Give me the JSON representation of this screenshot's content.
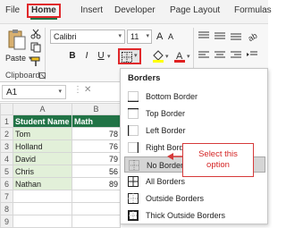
{
  "menu_tabs": [
    "File",
    "Home",
    "Insert",
    "Developer",
    "Page Layout",
    "Formulas"
  ],
  "ribbon": {
    "paste_label": "Paste",
    "clipboard_label": "Clipboard",
    "font_name": "Calibri",
    "font_size": "11",
    "bold": "B",
    "italic": "I",
    "underline": "U",
    "grow_font": "A",
    "shrink_font": "A"
  },
  "name_box": "A1",
  "sheet": {
    "columns": [
      "A",
      "B"
    ],
    "header_row": [
      "Student Name",
      "Math"
    ],
    "rows": [
      {
        "num": "2",
        "name": "Tom",
        "math": "78"
      },
      {
        "num": "3",
        "name": "Holland",
        "math": "76"
      },
      {
        "num": "4",
        "name": "David",
        "math": "79"
      },
      {
        "num": "5",
        "name": "Chris",
        "math": "56"
      },
      {
        "num": "6",
        "name": "Nathan",
        "math": "89"
      }
    ],
    "extra_rows": [
      "7",
      "8",
      "9"
    ]
  },
  "borders_menu": {
    "title": "Borders",
    "items": [
      "Bottom Border",
      "Top Border",
      "Left Border",
      "Right Border",
      "No Border",
      "All Borders",
      "Outside Borders",
      "Thick Outside Borders"
    ],
    "selected_index": 4
  },
  "callout": {
    "line1": "Select this",
    "line2": "option"
  },
  "colors": {
    "excel_green": "#217346",
    "highlight_red": "#e0282b",
    "name_fill": "#e2f0d9"
  }
}
